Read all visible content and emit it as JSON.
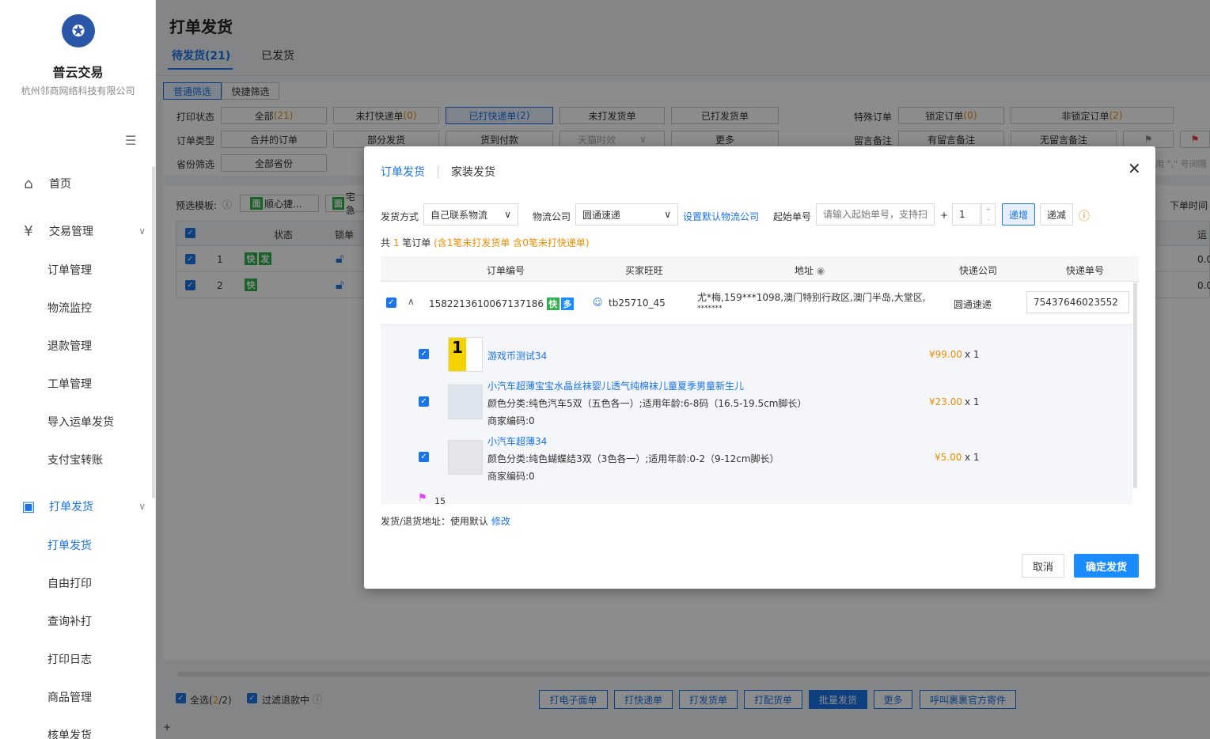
{
  "brand": {
    "name": "普云交易",
    "company": "杭州邻商网络科技有限公司"
  },
  "sidebar": {
    "home": "首页",
    "trade": {
      "label": "交易管理",
      "items": [
        "订单管理",
        "物流监控",
        "退款管理",
        "工单管理",
        "导入运单发货",
        "支付宝转账"
      ]
    },
    "print": {
      "label": "打单发货",
      "items": [
        "打单发货",
        "自由打印",
        "查询补打",
        "打印日志",
        "商品管理",
        "核单发货"
      ]
    }
  },
  "page": {
    "title": "打单发货",
    "tab_pending": "待发货(21)",
    "tab_shipped": "已发货"
  },
  "filters": {
    "mode_normal": "普通筛选",
    "mode_quick": "快捷筛选",
    "row1_label": "打印状态",
    "all": "全部",
    "all_count": "(21)",
    "not_express": "未打快递单",
    "not_express_count": "(0)",
    "printed_express": "已打快递单",
    "printed_express_count": "(2)",
    "not_ship_slip": "未打发货单",
    "printed_ship_slip": "已打发货单",
    "special_label": "特殊订单",
    "locked": "锁定订单",
    "locked_count": "(0)",
    "unlocked": "非锁定订单",
    "unlocked_count": "(2)",
    "row2_label": "订单类型",
    "merged": "合并的订单",
    "partial": "部分发货",
    "cod": "货到付款",
    "tmall": "天猫时效",
    "more": "更多",
    "memo_label": "留言备注",
    "has_memo": "有留言备注",
    "no_memo": "无留言备注",
    "row3_label": "省份筛选",
    "all_province": "全部省份",
    "hint": "用 \",\" 号间隔"
  },
  "table": {
    "template_label": "预选模板:",
    "template1": "顺心捷...",
    "template2": "宅急",
    "col_status": "状态",
    "col_lock": "锁单",
    "col_time": "下单时间",
    "col_ship": "运",
    "rows": [
      {
        "no": "1",
        "b1": "快",
        "b2": "发",
        "val": "0.0"
      },
      {
        "no": "2",
        "b1": "快",
        "val": "0.0"
      }
    ]
  },
  "bottom": {
    "select_all": "全选(",
    "sel": "2",
    "sel_total": "/2)",
    "filter_refund": "过滤退款中",
    "buttons": [
      "打电子面单",
      "打快递单",
      "打发货单",
      "打配货单",
      "批量发货",
      "更多",
      "呼叫裹裹官方寄件"
    ],
    "plus": "+"
  },
  "modal": {
    "tab_order": "订单发货",
    "tab_home": "家装发货",
    "ship_method_label": "发货方式",
    "ship_method": "自己联系物流",
    "company_label": "物流公司",
    "company": "圆通速递",
    "set_default": "设置默认物流公司",
    "start_no_label": "起始单号",
    "start_no_placeholder": "请输入起始单号，支持扫",
    "plus": "+",
    "step": "1",
    "inc": "递增",
    "dec": "递减",
    "summary_pre": "共 ",
    "summary_count": "1",
    "summary_mid": " 笔订单 ",
    "summary_note": "(含1笔未打发货单 含0笔未打快递单)",
    "cols": {
      "order": "订单编号",
      "buyer": "买家旺旺",
      "address": "地址",
      "express": "快递公司",
      "tracking": "快递单号"
    },
    "order": {
      "id": "1582213610067137186",
      "b1": "快",
      "b2": "多",
      "buyer": "tb25710_45",
      "address": "尤*梅,159***1098,澳门特别行政区,澳门半岛,大堂区,",
      "address2": "*******",
      "express": "圆通速递",
      "tracking": "75437646023552"
    },
    "items": [
      {
        "title": "游戏币测试34",
        "price": "¥99.00",
        "qty": "x 1"
      },
      {
        "title": "小汽车超薄宝宝水晶丝袜婴儿透气纯棉袜儿童夏季男童新生儿",
        "spec": "颜色分类:纯色汽车5双（五色各一）;适用年龄:6-8码（16.5-19.5cm脚长）",
        "code": "商家编码:0",
        "price": "¥23.00",
        "qty": "x 1"
      },
      {
        "title": "小汽车超薄34",
        "spec": "颜色分类:纯色蝴蝶结3双（3色各一）;适用年龄:0-2（9-12cm脚长）",
        "code": "商家编码:0",
        "price": "¥5.00",
        "qty": "x 1"
      }
    ],
    "flag_count": "15",
    "return_addr_label": "发货/退货地址：使用默认 ",
    "return_addr_edit": "修改",
    "cancel": "取消",
    "confirm": "确定发货"
  },
  "colors": {
    "accent": "#1a73e8",
    "orange": "#f08c00",
    "green": "#2db34a"
  }
}
